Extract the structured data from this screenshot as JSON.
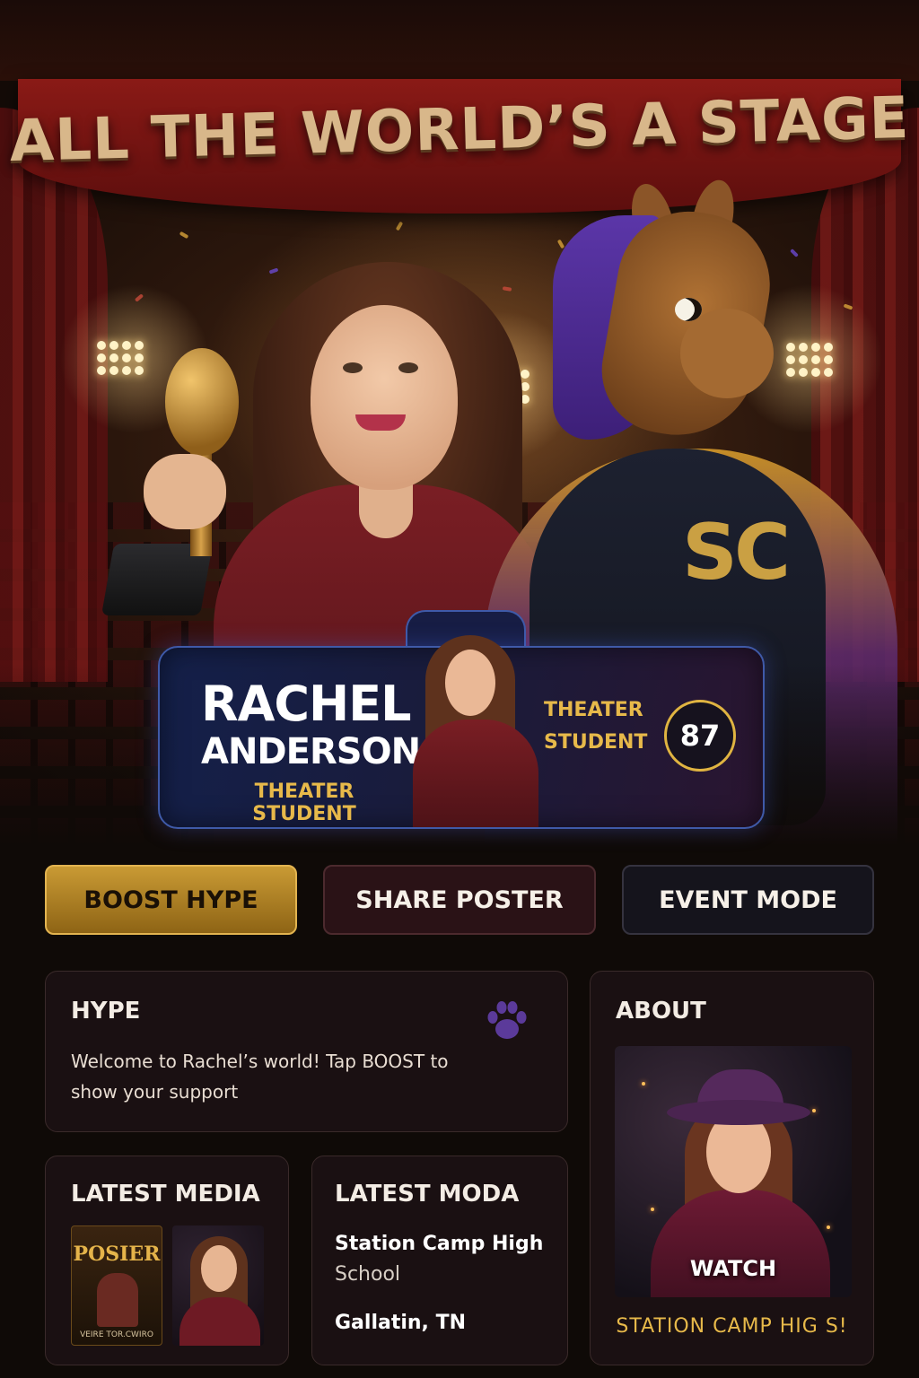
{
  "hero": {
    "banner_title": "ALL THE WORLD’S A STAGE",
    "mascot_jersey": "SC"
  },
  "profile": {
    "first_name": "RACHEL",
    "last_name": "ANDERSON",
    "role": "THEATER STUDENT",
    "role_line1": "THEATER",
    "role_line2": "STUDENT",
    "score": "87"
  },
  "actions": {
    "boost_label": "BOOST HYPE",
    "share_label": "SHARE POSTER",
    "event_label": "EVENT MODE"
  },
  "hype": {
    "title": "HYPE",
    "message": "Welcome to Rachel’s world! Tap BOOST to show your support",
    "icon": "paw-icon"
  },
  "about": {
    "title": "ABOUT",
    "watch_label": "WATCH",
    "caption": "STATION CAMP HIG S!"
  },
  "latest_media": {
    "title": "LATEST MEDIA",
    "poster_title": "POSIER",
    "poster_subtitle": "VEIRE TOR.CWIRO"
  },
  "latest_moda": {
    "title": "LATEST MODA",
    "school_strong": "Station Camp High",
    "school_rest": "School",
    "location": "Gallatin, TN"
  },
  "colors": {
    "accent_gold": "#e7b94a",
    "card_border": "#3f5aa8",
    "paw_purple": "#5b3a9a",
    "background": "#0f0a07"
  }
}
